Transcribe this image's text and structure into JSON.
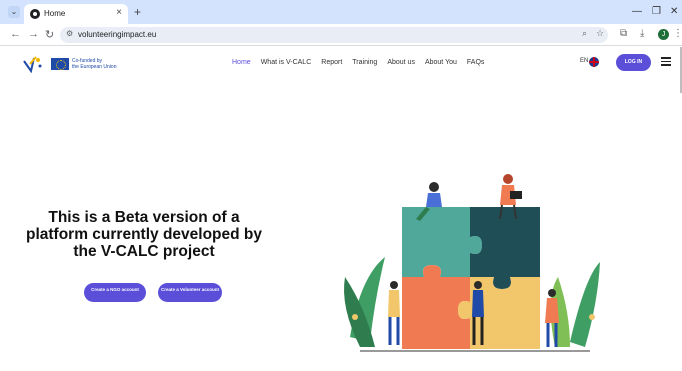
{
  "browser": {
    "tab_title": "Home",
    "url": "volunteeringimpact.eu",
    "new_tab": "+",
    "tab_close": "×",
    "tab_menu": "⌄",
    "minimize": "—",
    "restore": "❐",
    "close": "✕",
    "profile_initial": "J"
  },
  "header": {
    "eu_text_1": "Co-funded by",
    "eu_text_2": "the European Union",
    "nav": [
      "Home",
      "What is V-CALC",
      "Report",
      "Training",
      "About us",
      "About You",
      "FAQs"
    ],
    "lang": "EN",
    "login_label": "LOG IN"
  },
  "hero": {
    "title": "This is a Beta version of a platform currently developed by the V-CALC project",
    "cta_ngo": "Create a NGO account",
    "cta_volunteer": "Create a Volunteer account"
  },
  "colors": {
    "accent": "#5b4fd9",
    "puzzle_teal": "#4fa89a",
    "puzzle_dark": "#1f4e57",
    "puzzle_orange": "#f07a52",
    "puzzle_yellow": "#f2c66a"
  }
}
